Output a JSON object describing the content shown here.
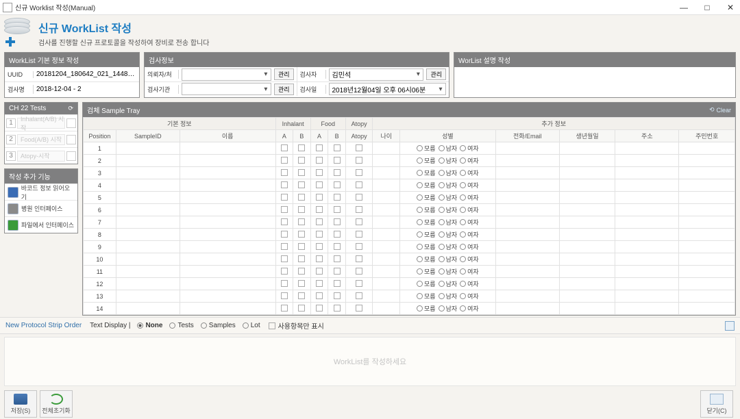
{
  "window": {
    "title": "신규 Worklist 작성(Manual)",
    "minimize": "—",
    "maximize": "□",
    "close": "✕"
  },
  "header": {
    "title": "신규 WorkList 작성",
    "subtitle": "검사를 진행할 신규 프로토콜을 작성하여 장비로 전송 합니다"
  },
  "basic_info": {
    "panel_title": "WorkList 기본 정보 작성",
    "uuid_label": "UUID",
    "uuid_value": "20181204_180642_021_1448…",
    "name_label": "검사명",
    "name_value": "2018-12-04 - 2"
  },
  "exam_info": {
    "panel_title": "검사정보",
    "requester_label": "의뢰자/처",
    "requester_value": "",
    "institution_label": "검사기관",
    "institution_value": "",
    "examiner_label": "검사자",
    "examiner_value": "김민석",
    "date_label": "검사일",
    "date_value": "2018년12월04일 오후 06시06분",
    "manage_btn": "관리"
  },
  "desc": {
    "panel_title": "WorList 설명 작성"
  },
  "ch22": {
    "panel_title": "CH 22 Tests",
    "reload_icon": "⟳",
    "rows": [
      {
        "num": "1",
        "placeholder": "Inhalant(A/B) 시작"
      },
      {
        "num": "2",
        "placeholder": "Food(A/B) 시작"
      },
      {
        "num": "3",
        "placeholder": "Atopy-시작"
      }
    ]
  },
  "extra_funcs": {
    "panel_title": "작성 추가 기능",
    "items": [
      "바코드 정보 읽어오기",
      "병원 인터페이스",
      "파일에서 인터페이스"
    ]
  },
  "tray": {
    "panel_title": "검체 Sample Tray",
    "clear_label": "Clear",
    "group_headers": {
      "basic": "기본 정보",
      "inhalant": "Inhalant",
      "food": "Food",
      "atopy": "Atopy",
      "extra": "추가 정보"
    },
    "columns": {
      "position": "Position",
      "sampleid": "SampleID",
      "name": "이름",
      "a1": "A",
      "b1": "B",
      "a2": "A",
      "b2": "B",
      "atopy": "Atopy",
      "age": "나이",
      "sex": "성별",
      "phone": "전화/Email",
      "birth": "생년월일",
      "addr": "주소",
      "ssn": "주민번호"
    },
    "sex_options": {
      "unknown": "모름",
      "male": "남자",
      "female": "여자"
    },
    "row_count": 14
  },
  "strip": {
    "title": "New Protocol Strip Order",
    "text_display_label": "Text Display |",
    "options": {
      "none": "None",
      "tests": "Tests",
      "samples": "Samples",
      "lot": "Lot"
    },
    "used_only": "사용항목만 표시",
    "placeholder": "WorkList를 작성하세요"
  },
  "footer": {
    "save": "저장(S)",
    "reset": "전체초기화",
    "close": "닫기(C)"
  }
}
